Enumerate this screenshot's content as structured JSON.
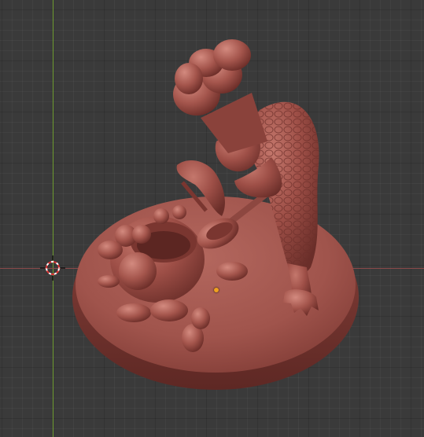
{
  "viewport": {
    "background_color": "#3a3a3a",
    "grid_line_color": "#2e2e2e",
    "axis_x_color": "#8a4a4a",
    "axis_y_color": "#6e9b2e",
    "model_color": "#a0524a",
    "origin_color": "#f0a020"
  },
  "icons": {
    "cursor": "3d-cursor-icon",
    "origin": "object-origin-icon"
  }
}
